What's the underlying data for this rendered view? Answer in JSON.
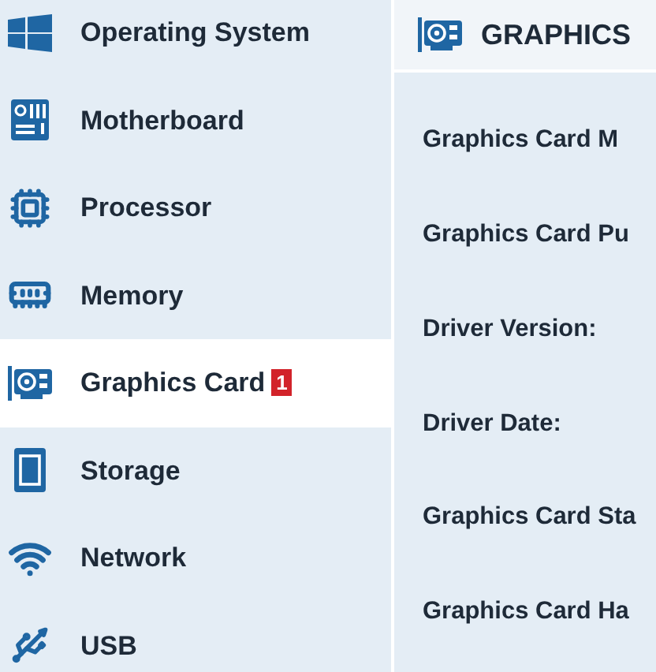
{
  "sidebar": {
    "items": [
      {
        "label": "Operating System",
        "selected": false
      },
      {
        "label": "Motherboard",
        "selected": false
      },
      {
        "label": "Processor",
        "selected": false
      },
      {
        "label": "Memory",
        "selected": false
      },
      {
        "label": "Graphics Card",
        "selected": true,
        "badge": "1"
      },
      {
        "label": "Storage",
        "selected": false
      },
      {
        "label": "Network",
        "selected": false
      },
      {
        "label": "USB",
        "selected": false
      }
    ]
  },
  "panel": {
    "title": "GRAPHICS",
    "rows": [
      {
        "label": "Graphics Card M"
      },
      {
        "label": "Graphics Card Pu"
      },
      {
        "label": "Driver Version:"
      },
      {
        "label": "Driver Date:"
      },
      {
        "label": "Graphics Card Sta"
      },
      {
        "label": "Graphics Card Ha"
      }
    ]
  }
}
